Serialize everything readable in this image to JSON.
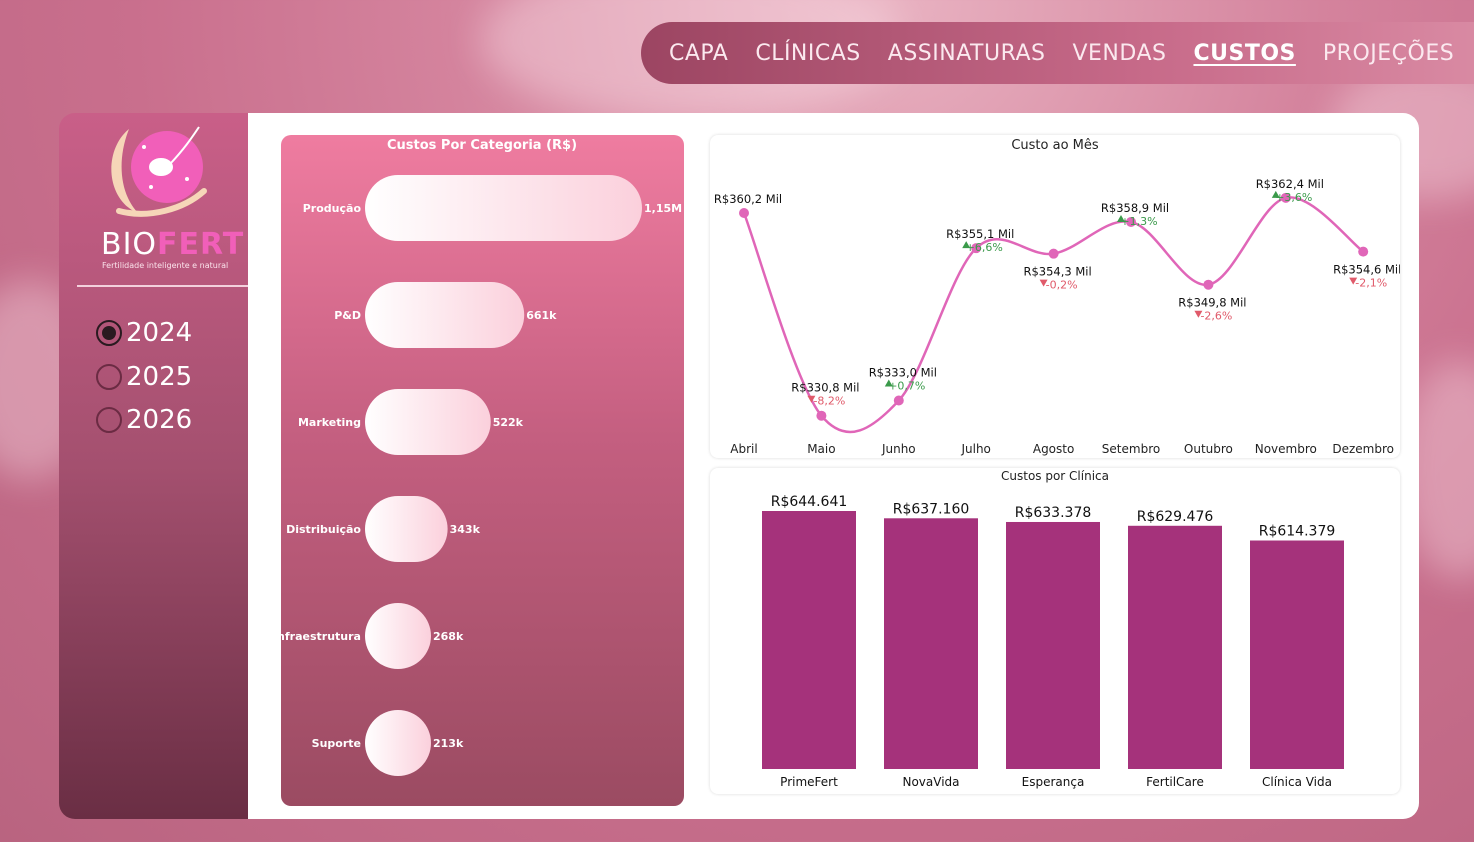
{
  "nav": {
    "items": [
      {
        "label": "CAPA",
        "active": false
      },
      {
        "label": "CLÍNICAS",
        "active": false
      },
      {
        "label": "ASSINATURAS",
        "active": false
      },
      {
        "label": "VENDAS",
        "active": false
      },
      {
        "label": "CUSTOS",
        "active": true
      },
      {
        "label": "PROJEÇÕES",
        "active": false
      }
    ]
  },
  "brand": {
    "name_part1": "BIO",
    "name_part2": "FERT",
    "tagline": "Fertilidade inteligente e natural"
  },
  "years": [
    {
      "label": "2024",
      "selected": true
    },
    {
      "label": "2025",
      "selected": false
    },
    {
      "label": "2026",
      "selected": false
    }
  ],
  "colors": {
    "accent": "#f15fb9",
    "line": "#e066b8",
    "bar": "#a5327b",
    "up": "#3a9a4a",
    "down": "#e05a6a"
  },
  "chart_data": [
    {
      "type": "bar",
      "orientation": "horizontal",
      "title": "Custos Por Categoria (R$)",
      "categories": [
        "Produção",
        "P&D",
        "Marketing",
        "Distribuição",
        "Infraestrutura",
        "Suporte"
      ],
      "values": [
        1150000,
        661000,
        522000,
        343000,
        268000,
        213000
      ],
      "labels": [
        "1,15M",
        "661k",
        "522k",
        "343k",
        "268k",
        "213k"
      ]
    },
    {
      "type": "line",
      "title": "Custo ao Mês",
      "categories": [
        "Abril",
        "Maio",
        "Junho",
        "Julho",
        "Agosto",
        "Setembro",
        "Outubro",
        "Novembro",
        "Dezembro"
      ],
      "values": [
        360.2,
        330.8,
        333.0,
        355.1,
        354.3,
        358.9,
        349.8,
        362.4,
        354.6
      ],
      "labels": [
        "R$360,2 Mil",
        "R$330,8 Mil",
        "R$333,0 Mil",
        "R$355,1 Mil",
        "R$354,3 Mil",
        "R$358,9 Mil",
        "R$349,8 Mil",
        "R$362,4 Mil",
        "R$354,6 Mil"
      ],
      "changes": [
        "",
        "-8,2%",
        "+0,7%",
        "+6,6%",
        "-0,2%",
        "+1,3%",
        "-2,6%",
        "+3,6%",
        "-2,1%"
      ],
      "ylim": [
        328,
        366
      ]
    },
    {
      "type": "bar",
      "title": "Custos por Clínica",
      "categories": [
        "PrimeFert",
        "NovaVida",
        "Esperança",
        "FertilCare",
        "Clínica Vida"
      ],
      "values": [
        644641,
        637160,
        633378,
        629476,
        614379
      ],
      "labels": [
        "R$644.641",
        "R$637.160",
        "R$633.378",
        "R$629.476",
        "R$614.379"
      ]
    }
  ]
}
